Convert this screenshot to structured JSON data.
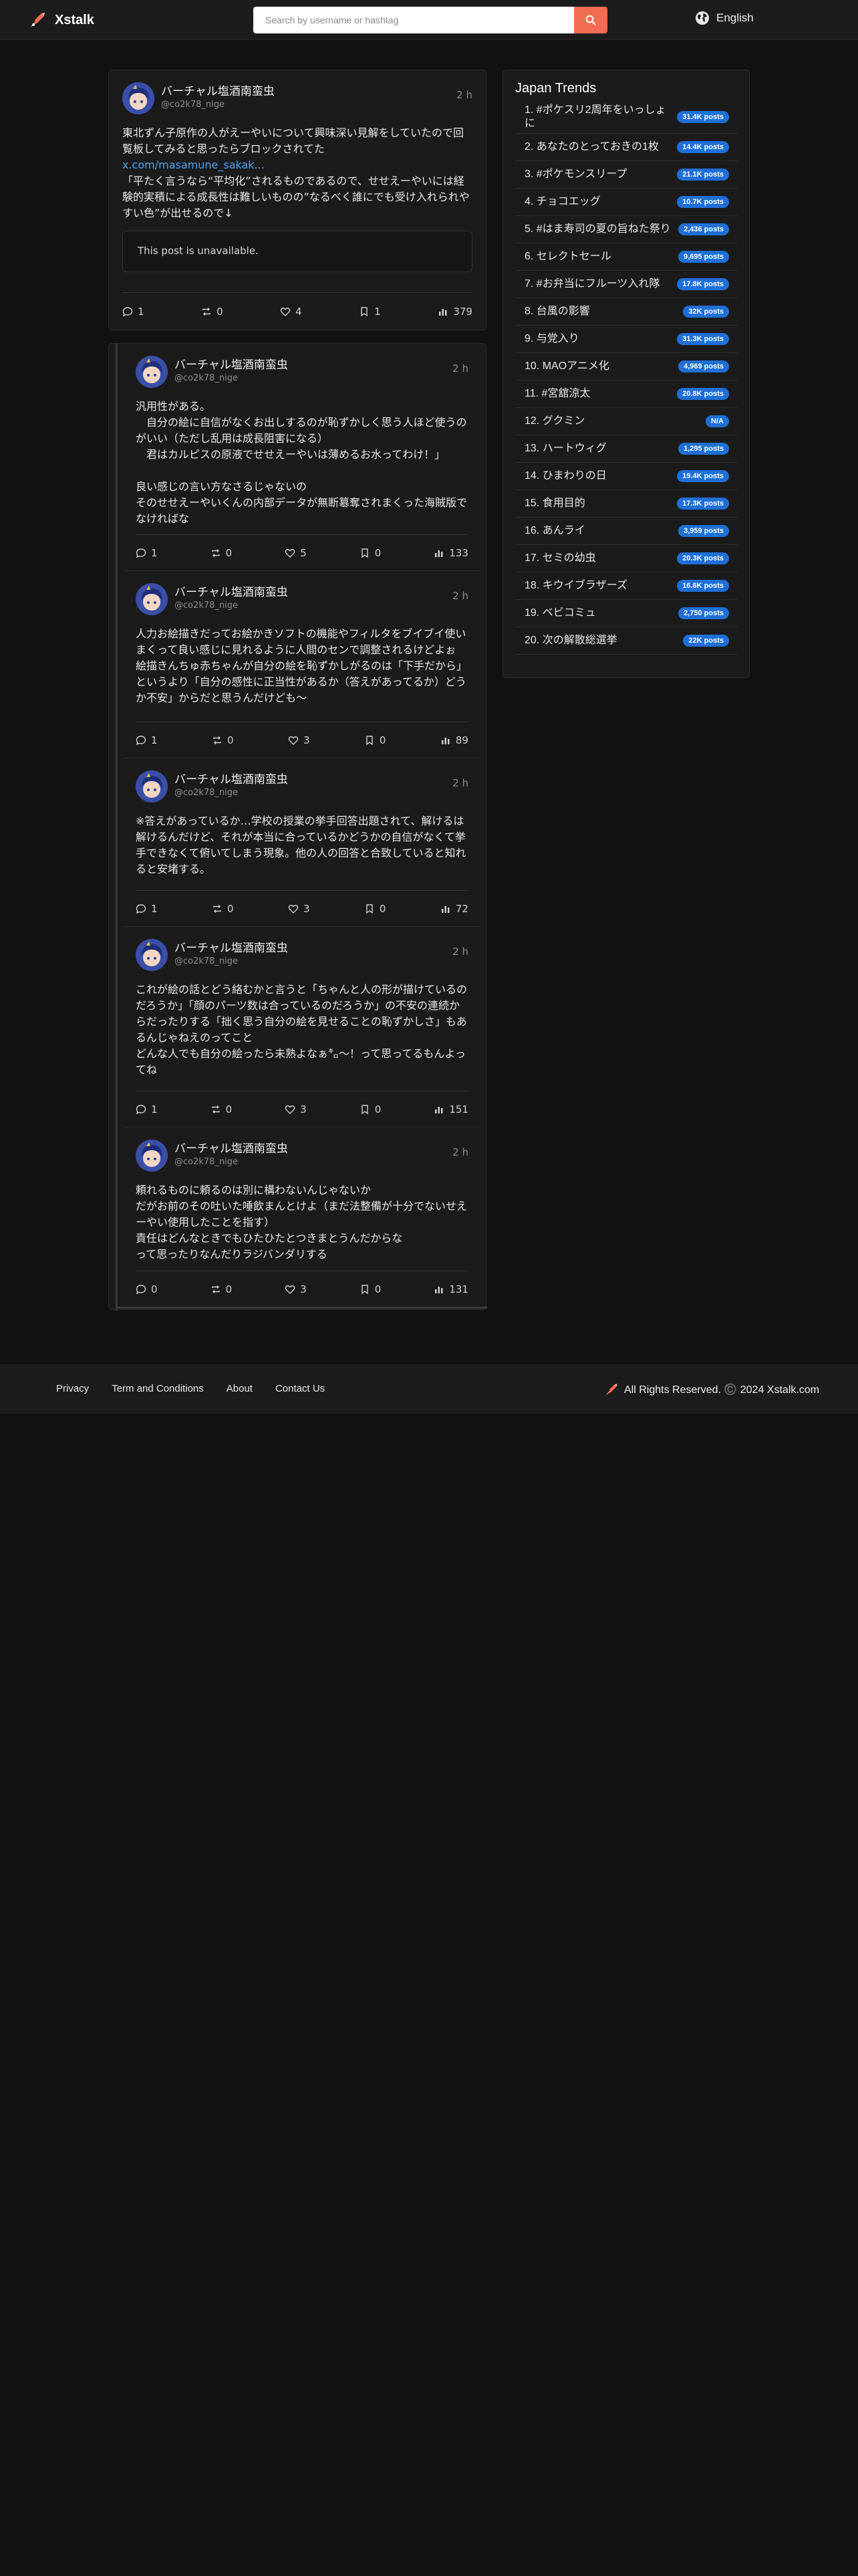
{
  "header": {
    "brand": "Xstalk",
    "search_placeholder": "Search by username or hashtag",
    "language": "English"
  },
  "main_post": {
    "display_name": "バーチャル塩酒南蛮虫",
    "username": "@co2k78_nige",
    "time": "2 h",
    "text_before_link": "東北ずん子原作の人がえーやいについて興味深い見解をしていたので回覧板してみると思ったらブロックされてた",
    "link": "x.com/masamune_sakak...",
    "text_after_link": "「平たく言うなら“平均化”されるものであるので、せせえーやいには経験的実積による成長性は難しいものの”なるべく誰にでも受け入れられやすい色”が出せるので↓",
    "quoted": "This post is unavailable.",
    "stats": {
      "replies": "1",
      "reposts": "0",
      "likes": "4",
      "bookmarks": "1",
      "views": "379"
    }
  },
  "replies": [
    {
      "display_name": "バーチャル塩酒南蛮虫",
      "username": "@co2k78_nige",
      "time": "2 h",
      "text": "汎用性がある。\n　自分の絵に自信がなくお出しするのが恥ずかしく思う人ほど使うのがいい（ただし乱用は成長阻害になる）\n　君はカルピスの原液でせせえーやいは薄めるお水ってわけ！」\n\n良い感じの言い方なさるじゃないの\nそのせせえーやいくんの内部データが無断簒奪されまくった海賊版でなければな",
      "stats": {
        "replies": "1",
        "reposts": "0",
        "likes": "5",
        "bookmarks": "0",
        "views": "133"
      }
    },
    {
      "display_name": "バーチャル塩酒南蛮虫",
      "username": "@co2k78_nige",
      "time": "2 h",
      "text": "人力お絵描きだってお絵かきソフトの機能やフィルタをブイブイ使いまくって良い感じに見れるように人間のセンで調整されるけどよぉ\n絵描きんちゅ赤ちゃんが自分の絵を恥ずかしがるのは「下手だから」というより「自分の感性に正当性があるか（答えがあってるか）どうか不安」からだと思うんだけども〜",
      "stats": {
        "replies": "1",
        "reposts": "0",
        "likes": "3",
        "bookmarks": "0",
        "views": "89"
      }
    },
    {
      "display_name": "バーチャル塩酒南蛮虫",
      "username": "@co2k78_nige",
      "time": "2 h",
      "text": "※答えがあっているか…学校の授業の挙手回答出題されて、解けるは解けるんだけど、それが本当に合っているかどうかの自信がなくて挙手できなくて俯いてしまう現象。他の人の回答と合致していると知れると安堵する。",
      "stats": {
        "replies": "1",
        "reposts": "0",
        "likes": "3",
        "bookmarks": "0",
        "views": "72"
      }
    },
    {
      "display_name": "バーチャル塩酒南蛮虫",
      "username": "@co2k78_nige",
      "time": "2 h",
      "text": "これが絵の話とどう絡むかと言うと「ちゃんと人の形が描けているのだろうか」「顔のパーツ数は合っているのだろうか」の不安の連続からだったりする「拙く思う自分の絵を見せることの恥ずかしさ」もあるんじゃねえのってこと\nどんな人でも自分の絵ったら未熟よなぁ㌔〜！って思ってるもんよってね",
      "stats": {
        "replies": "1",
        "reposts": "0",
        "likes": "3",
        "bookmarks": "0",
        "views": "151"
      }
    },
    {
      "display_name": "バーチャル塩酒南蛮虫",
      "username": "@co2k78_nige",
      "time": "2 h",
      "text": "頼れるものに頼るのは別に構わないんじゃないか\nだがお前のその吐いた唾飲まんとけよ（まだ法整備が十分でないせえーやい使用したことを指す）\n責任はどんなときでもひたひたとつきまとうんだからな\nって思ったりなんだりラジバンダリする",
      "stats": {
        "replies": "0",
        "reposts": "0",
        "likes": "3",
        "bookmarks": "0",
        "views": "131"
      }
    }
  ],
  "trends": {
    "title": "Japan Trends",
    "items": [
      {
        "label": "1. #ポケスリ2周年をいっしょに",
        "count": "31.4K posts"
      },
      {
        "label": "2. あなたのとっておきの1枚",
        "count": "14.4K posts"
      },
      {
        "label": "3. #ポケモンスリープ",
        "count": "21.1K posts"
      },
      {
        "label": "4. チョコエッグ",
        "count": "10.7K posts"
      },
      {
        "label": "5. #はま寿司の夏の旨ねた祭り",
        "count": "2,436 posts"
      },
      {
        "label": "6. セレクトセール",
        "count": "9,695 posts"
      },
      {
        "label": "7. #お弁当にフルーツ入れ隊",
        "count": "17.8K posts"
      },
      {
        "label": "8. 台風の影響",
        "count": "32K posts"
      },
      {
        "label": "9. 与党入り",
        "count": "31.3K posts"
      },
      {
        "label": "10. MAOアニメ化",
        "count": "4,969 posts"
      },
      {
        "label": "11. #宮舘涼太",
        "count": "20.8K posts"
      },
      {
        "label": "12. グクミン",
        "count": "N/A"
      },
      {
        "label": "13. ハートウィグ",
        "count": "1,295 posts"
      },
      {
        "label": "14. ひまわりの日",
        "count": "19.4K posts"
      },
      {
        "label": "15. 食用目的",
        "count": "17.3K posts"
      },
      {
        "label": "16. あんライ",
        "count": "3,959 posts"
      },
      {
        "label": "17. セミの幼虫",
        "count": "20.3K posts"
      },
      {
        "label": "18. キウイブラザーズ",
        "count": "16.6K posts"
      },
      {
        "label": "19. ベビコミュ",
        "count": "2,750 posts"
      },
      {
        "label": "20. 次の解散総選挙",
        "count": "22K posts"
      }
    ]
  },
  "footer": {
    "links": [
      "Privacy",
      "Term and Conditions",
      "About",
      "Contact Us"
    ],
    "copyright": "All Rights Reserved. ©️ 2024 Xstalk.com"
  },
  "colors": {
    "background": "#111111",
    "card": "#1b1b1b",
    "accent": "#f36d55",
    "badge": "#1f6fd6",
    "link": "#4ea2f0"
  }
}
